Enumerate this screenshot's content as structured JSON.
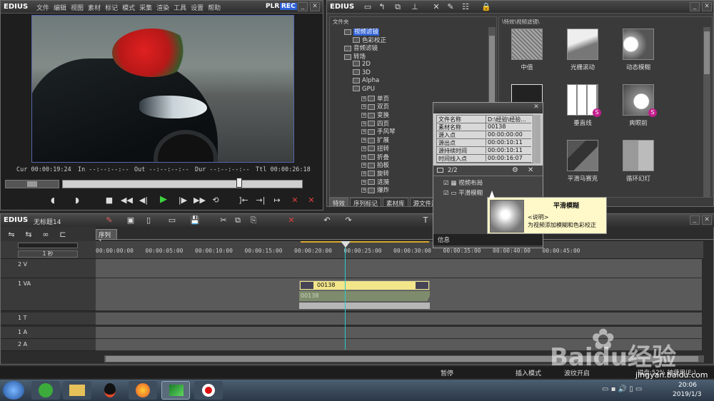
{
  "player": {
    "logo": "EDIUS",
    "menu": [
      "文件",
      "编辑",
      "视图",
      "素材",
      "标记",
      "模式",
      "采集",
      "渲染",
      "工具",
      "设置",
      "帮助"
    ],
    "plr": "PLR",
    "rec": "REC",
    "cur_label": "Cur",
    "cur_value": "00:00:19:24",
    "in_label": "In",
    "in_value": "--:--:--:--",
    "out_label": "Out",
    "out_value": "--:--:--:--",
    "dur_label": "Dur",
    "dur_value": "--:--:--:--",
    "ttl_label": "Ttl",
    "ttl_value": "00:00:26:18"
  },
  "bin": {
    "logo": "EDIUS",
    "folder_header": "文件夹",
    "tree": [
      {
        "label": "视频滤镜",
        "level": 1,
        "selected": true
      },
      {
        "label": "色彩校正",
        "level": 2
      },
      {
        "label": "音频滤镜",
        "level": 1
      },
      {
        "label": "转场",
        "level": 1
      },
      {
        "label": "2D",
        "level": 2
      },
      {
        "label": "3D",
        "level": 2
      },
      {
        "label": "Alpha",
        "level": 2
      },
      {
        "label": "GPU",
        "level": 2
      },
      {
        "label": "单页",
        "level": 3
      },
      {
        "label": "双页",
        "level": 3
      },
      {
        "label": "变换",
        "level": 3
      },
      {
        "label": "四页",
        "level": 3
      },
      {
        "label": "手风琴",
        "level": 3
      },
      {
        "label": "扩展",
        "level": 3
      },
      {
        "label": "扭转",
        "level": 3
      },
      {
        "label": "折叠",
        "level": 3
      },
      {
        "label": "拍板",
        "level": 3
      },
      {
        "label": "旋转",
        "level": 3
      },
      {
        "label": "涟漪",
        "level": 3
      },
      {
        "label": "爆炸",
        "level": 3
      }
    ],
    "path": "\\特效\\视频滤镜\\",
    "effects": [
      "中值",
      "光栅滚动",
      "动态模糊",
      "",
      "垂直线",
      "爽眼前",
      "",
      "平滑马赛克",
      "循环幻灯"
    ],
    "tabs": [
      "特效",
      "序列标记",
      "素材库",
      "源文件浏"
    ]
  },
  "props": {
    "rows": [
      {
        "k": "文件名称",
        "v": "D:\\经验\\经验..."
      },
      {
        "k": "素材名称",
        "v": "00138"
      },
      {
        "k": "源入点",
        "v": "00:00:00:00"
      },
      {
        "k": "源出点",
        "v": "00:00:10:11"
      },
      {
        "k": "源持续时间",
        "v": "00:00:10:11"
      },
      {
        "k": "时间线入点",
        "v": "00:00:16:07"
      }
    ],
    "count": "2/2",
    "filters": [
      "视频布局",
      "平滑模糊"
    ],
    "info_label": "信息"
  },
  "tooltip": {
    "title": "平滑模糊",
    "desc_label": "<说明>",
    "desc": "为视频添加模糊和色彩校正"
  },
  "timeline": {
    "logo": "EDIUS",
    "project": "无标题14",
    "sequence_tab": "序列1",
    "zoom": "1 秒",
    "ruler": [
      "00:00:00:00",
      "00:00:05:00",
      "00:00:10:00",
      "00:00:15:00",
      "00:00:20:00",
      "00:00:25:00",
      "00:00:30:00",
      "00:00:35:00",
      "00:00:40:00",
      "00:00:45:00"
    ],
    "tracks": [
      "2 V",
      "1 VA",
      "1 T",
      "1 A",
      "2 A"
    ],
    "clip_name": "00138",
    "clip_audio": "00138"
  },
  "status": {
    "items": [
      "暂停",
      "插入模式",
      "波纹开启",
      "磁盘:52% 被使用(E:)"
    ]
  },
  "taskbar": {
    "time": "20:06",
    "date": "2019/1/3"
  },
  "watermark": {
    "text": "Baidu经验",
    "url": "jingyan.baidu.com"
  },
  "colors": {
    "rec": "#2d5fd6",
    "clip": "#f3e58a",
    "audio_clip": "#7e8c6d",
    "play": "#3fd13f",
    "playhead": "#2ec9c9"
  }
}
